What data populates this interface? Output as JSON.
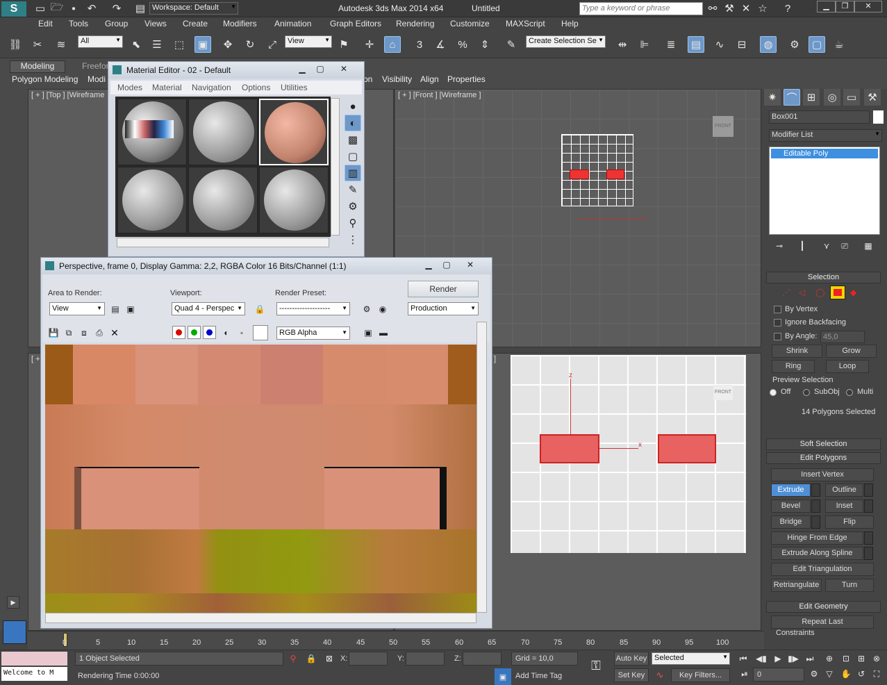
{
  "title_bar": {
    "workspace": "Workspace: Default",
    "app_title": "Autodesk 3ds Max  2014 x64",
    "doc": "Untitled",
    "search_placeholder": "Type a keyword or phrase"
  },
  "menu": [
    "Edit",
    "Tools",
    "Group",
    "Views",
    "Create",
    "Modifiers",
    "Animation",
    "Graph Editors",
    "Rendering",
    "Customize",
    "MAXScript",
    "Help"
  ],
  "main_toolbar": {
    "filter": "All",
    "ref_coord": "View",
    "selection_set": "Create Selection Se"
  },
  "ribbon": {
    "tabs": [
      "Modeling",
      "Freeform"
    ],
    "sub": [
      "Polygon Modeling",
      "Modi"
    ],
    "right": [
      "Visibility",
      "Align",
      "Properties"
    ],
    "extra": "on"
  },
  "viewports": {
    "top": "[ + ] [Top ] [Wireframe",
    "front": "[ + ] [Front ] [Wireframe ]",
    "left_small": "[ +",
    "persp_small": "]",
    "cube_front": "FRONT"
  },
  "axes": {
    "z": "z",
    "x": "x"
  },
  "material_editor": {
    "title": "Material Editor - 02 - Default",
    "menus": [
      "Modes",
      "Material",
      "Navigation",
      "Options",
      "Utilities"
    ]
  },
  "render_window": {
    "title": "Perspective, frame 0, Display Gamma: 2,2, RGBA Color 16 Bits/Channel (1:1)",
    "area_label": "Area to Render:",
    "area_value": "View",
    "viewport_label": "Viewport:",
    "viewport_value": "Quad 4 - Perspec",
    "preset_label": "Render Preset:",
    "preset_value": "--------------------",
    "render_button": "Render",
    "production": "Production",
    "channel": "RGB Alpha"
  },
  "command_panel": {
    "object_name": "Box001",
    "modifier_list": "Modifier List",
    "stack_item": "Editable Poly",
    "selection_header": "Selection",
    "by_vertex": "By Vertex",
    "ignore_backfacing": "Ignore Backfacing",
    "by_angle": "By Angle:",
    "angle_value": "45,0",
    "shrink": "Shrink",
    "grow": "Grow",
    "ring": "Ring",
    "loop": "Loop",
    "preview_selection": "Preview Selection",
    "off": "Off",
    "subobj": "SubObj",
    "multi": "Multi",
    "poly_count": "14 Polygons Selected",
    "soft_selection": "Soft Selection",
    "edit_polygons": "Edit Polygons",
    "insert_vertex": "Insert Vertex",
    "extrude": "Extrude",
    "outline": "Outline",
    "bevel": "Bevel",
    "inset": "Inset",
    "bridge": "Bridge",
    "flip": "Flip",
    "hinge": "Hinge From Edge",
    "extrude_spline": "Extrude Along Spline",
    "edit_triangulation": "Edit Triangulation",
    "retriangulate": "Retriangulate",
    "turn": "Turn",
    "edit_geometry": "Edit Geometry",
    "repeat_last": "Repeat Last",
    "constraints": "Constraints"
  },
  "timeline": {
    "ticks": [
      "0",
      "5",
      "10",
      "15",
      "20",
      "25",
      "30",
      "35",
      "40",
      "45",
      "50",
      "55",
      "60",
      "65",
      "70",
      "75",
      "80",
      "85",
      "90",
      "95",
      "100"
    ]
  },
  "status": {
    "selected": "1 Object Selected",
    "render_time": "Rendering Time  0:00:00",
    "x": "X:",
    "y": "Y:",
    "z": "Z:",
    "grid": "Grid = 10,0",
    "add_time_tag": "Add Time Tag",
    "auto_key": "Auto Key",
    "set_key": "Set Key",
    "key_mode": "Selected",
    "key_filters": "Key Filters...",
    "frame": "0",
    "welcome": "Welcome to M"
  }
}
